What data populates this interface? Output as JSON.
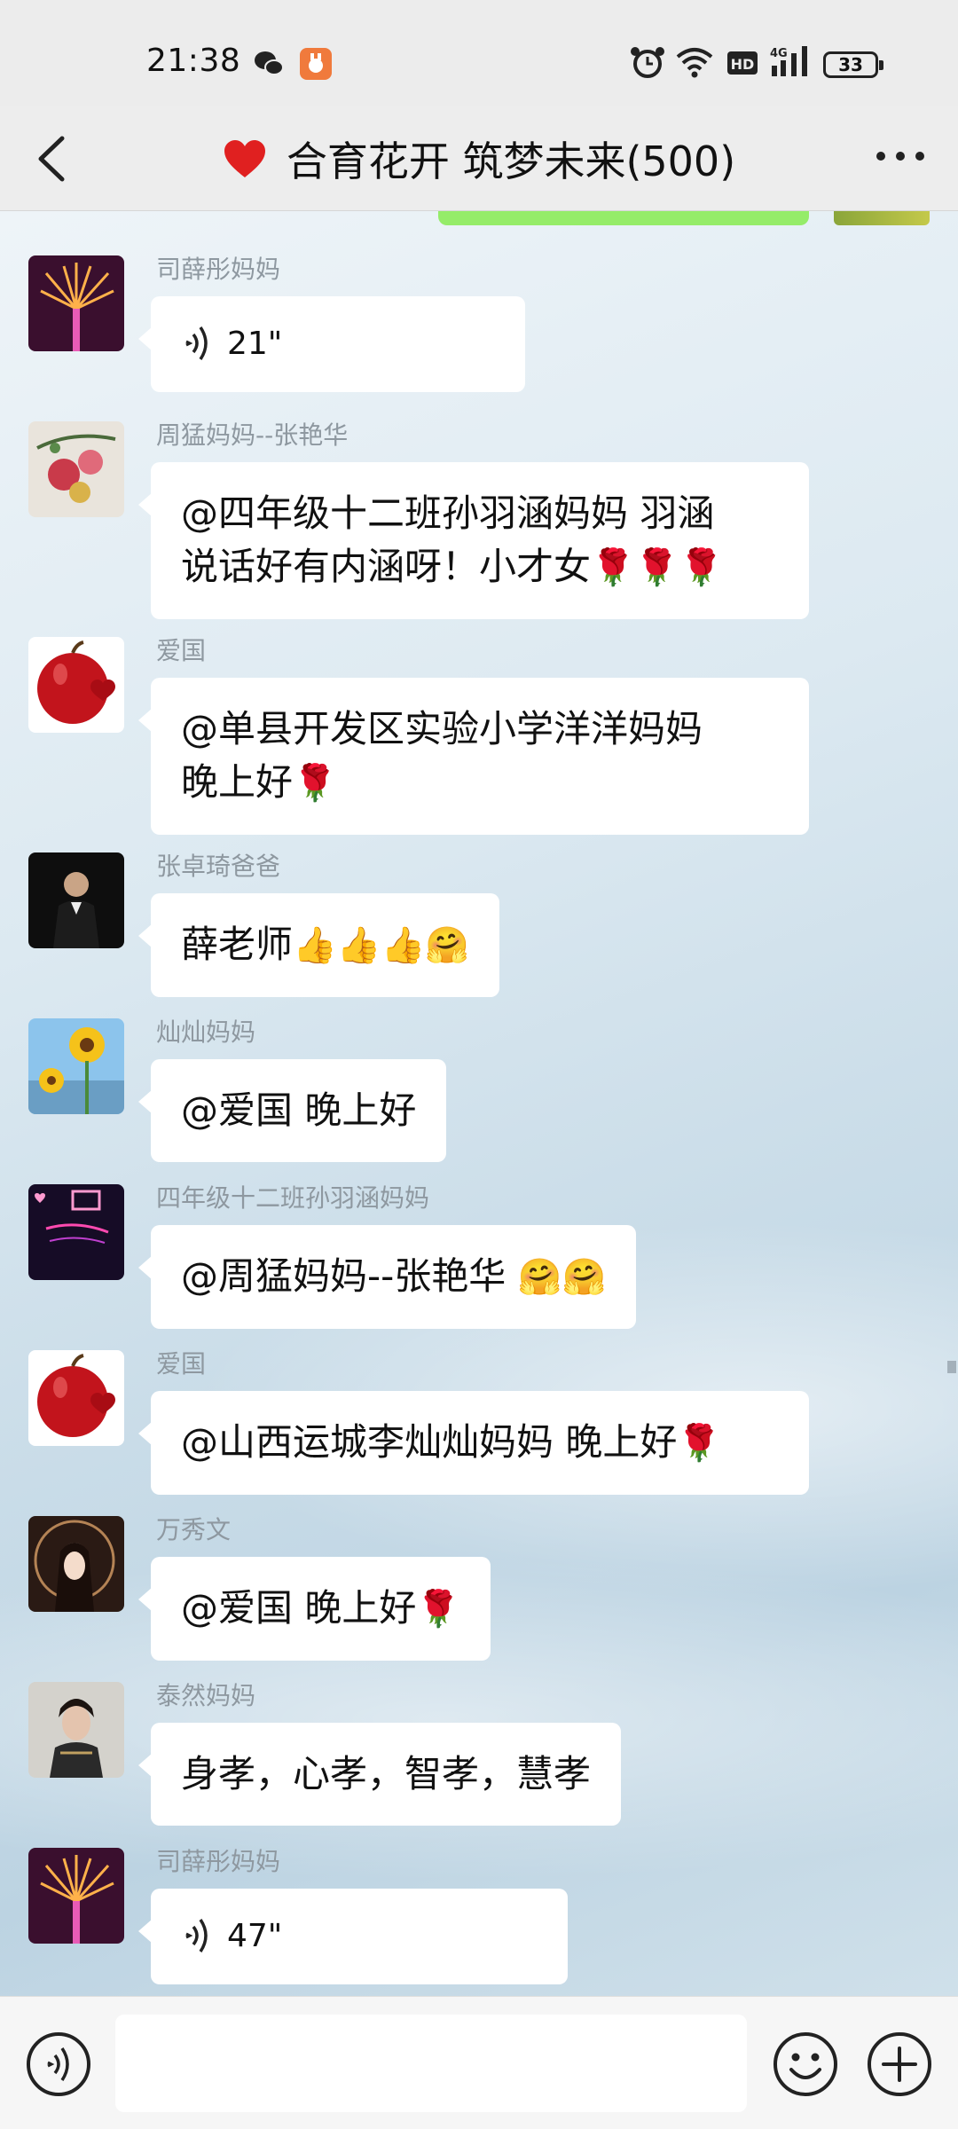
{
  "status_bar": {
    "time": "21:38",
    "battery": "33",
    "hd_label": "HD",
    "network_label": "4G"
  },
  "nav": {
    "title": "合育花开 筑梦未来(500)",
    "title_icon": "red-heart-icon"
  },
  "messages": [
    {
      "sender": "司薛彤妈妈",
      "type": "voice",
      "duration": "21\""
    },
    {
      "sender": "周猛妈妈--张艳华",
      "type": "text",
      "lines": [
        "@四年级十二班孙羽涵妈妈  羽涵",
        "说话好有内涵呀！小才女"
      ],
      "emoji": "🌹🌹🌹"
    },
    {
      "sender": "爱国",
      "type": "text",
      "lines": [
        "@单县开发区实验小学洋洋妈妈",
        "晚上好"
      ],
      "emoji": "🌹"
    },
    {
      "sender": "张卓琦爸爸",
      "type": "text",
      "lines": [
        "薛老师"
      ],
      "emoji": "👍👍👍🤗"
    },
    {
      "sender": "灿灿妈妈",
      "type": "text",
      "lines": [
        "@爱国  晚上好"
      ],
      "emoji": ""
    },
    {
      "sender": "四年级十二班孙羽涵妈妈",
      "type": "text",
      "lines": [
        "@周猛妈妈--张艳华 "
      ],
      "emoji": "🤗🤗"
    },
    {
      "sender": "爱国",
      "type": "text",
      "lines": [
        "@山西运城李灿灿妈妈  晚上好"
      ],
      "emoji": "🌹"
    },
    {
      "sender": "万秀文",
      "type": "text",
      "lines": [
        "@爱国  晚上好"
      ],
      "emoji": "🌹"
    },
    {
      "sender": "泰然妈妈",
      "type": "text",
      "lines": [
        "身孝，心孝，智孝，慧孝"
      ],
      "emoji": ""
    },
    {
      "sender": "司薛彤妈妈",
      "type": "voice",
      "duration": "47\""
    }
  ],
  "input_bar": {
    "voice_icon": "voice-input-icon",
    "emoji_icon": "emoji-icon",
    "plus_icon": "plus-icon"
  },
  "colors": {
    "bubble": "#ffffff",
    "self_bubble": "#95ec69",
    "sender_name": "#8e98a0",
    "accent_red": "#e02020"
  }
}
